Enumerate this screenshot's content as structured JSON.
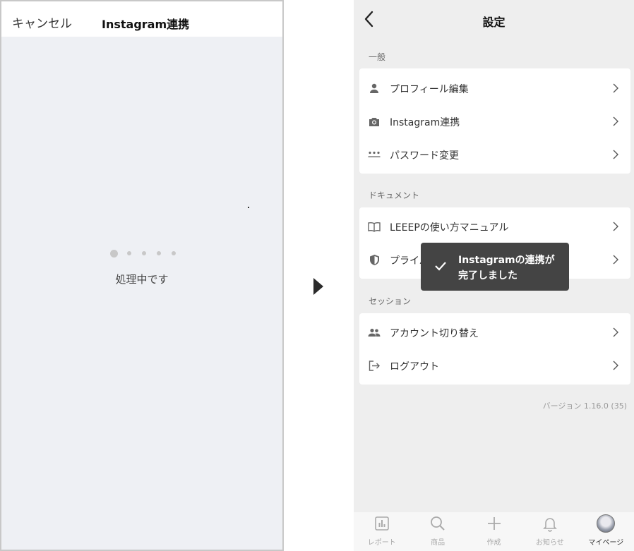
{
  "left": {
    "cancel_label": "キャンセル",
    "title": "Instagram連携",
    "processing": "処理中です"
  },
  "right": {
    "title": "設定",
    "sections": [
      {
        "label": "一般",
        "items": [
          {
            "label": "プロフィール編集",
            "icon": "person-icon"
          },
          {
            "label": "Instagram連携",
            "icon": "camera-icon"
          },
          {
            "label": "パスワード変更",
            "icon": "password-dots-icon"
          }
        ]
      },
      {
        "label": "ドキュメント",
        "items": [
          {
            "label": "LEEEPの使い方マニュアル",
            "icon": "book-icon"
          },
          {
            "label": "プライバシーポリシー",
            "icon": "shield-icon"
          }
        ]
      },
      {
        "label": "セッション",
        "items": [
          {
            "label": "アカウント切り替え",
            "icon": "people-icon"
          },
          {
            "label": "ログアウト",
            "icon": "logout-icon"
          }
        ]
      }
    ],
    "toast": {
      "line1": "Instagramの連携が",
      "line2": "完了しました"
    },
    "version": "バージョン 1.16.0 (35)",
    "tabs": [
      {
        "label": "レポート",
        "icon": "chart-icon"
      },
      {
        "label": "商品",
        "icon": "search-icon"
      },
      {
        "label": "作成",
        "icon": "plus-icon"
      },
      {
        "label": "お知らせ",
        "icon": "bell-icon"
      },
      {
        "label": "マイページ",
        "icon": "avatar"
      }
    ]
  },
  "colors": {
    "left_background": "#eef0f4",
    "right_background": "#eeeeee",
    "toast_background": "#444444"
  }
}
